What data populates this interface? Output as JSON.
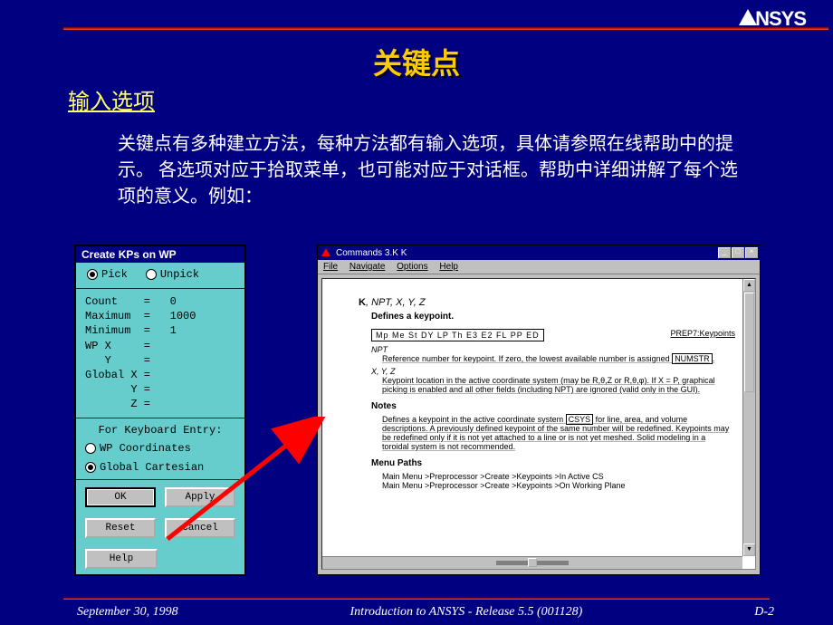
{
  "logo": "NSYS",
  "title": "关键点",
  "subtitle": "输入选项",
  "body": "关键点有多种建立方法，每种方法都有输入选项，具体请参照在线帮助中的提示。 各选项对应于拾取菜单，也可能对应于对话框。帮助中详细讲解了每个选项的意义。例如：",
  "dialog": {
    "title": "Create KPs on WP",
    "pick": "Pick",
    "unpick": "Unpick",
    "kv_lines": "Count    =   0\nMaximum  =   1000\nMinimum  =   1\nWP X     =\n   Y     =\nGlobal X =\n       Y =\n       Z =",
    "entry_label": "For Keyboard Entry:",
    "wp_coords": "WP Coordinates",
    "global_cart": "Global Cartesian",
    "ok": "OK",
    "apply": "Apply",
    "reset": "Reset",
    "cancel": "Cancel",
    "help": "Help"
  },
  "helpwin": {
    "title": "Commands 3.K K",
    "menus": [
      "File",
      "Navigate",
      "Options",
      "Help"
    ],
    "cmd_sig_bold": "K",
    "cmd_sig_rest": ", NPT, X, Y, Z",
    "defines": "Defines a keypoint.",
    "right_link": "PREP7:Keypoints",
    "toolbar": "Mp Me St DY LP Th E3 E2 FL PP ED",
    "arg1_name": "NPT",
    "arg1_text_a": "Reference number for keypoint.  If zero, the lowest available number is assigned",
    "arg1_box": "NUMSTR",
    "arg1_text_b": ".",
    "arg2_name": "X, Y, Z",
    "arg2_text": "Keypoint location in the active coordinate system (may be R,θ,Z or R,θ,φ).  If X = P, graphical picking is enabled and all other fields (including NPT) are ignored (valid only in the GUI).",
    "notes_h": "Notes",
    "notes_text_a": "Defines a keypoint in the active coordinate system ",
    "notes_box": "CSYS",
    "notes_text_b": " for line, area, and volume descriptions.  A previously defined keypoint of the same number will be redefined.  Keypoints may be redefined only if it is not yet attached to a line or is not yet meshed.  Solid modeling in a toroidal system is not recommended.",
    "menupaths_h": "Menu Paths",
    "mp1": "Main Menu >Preprocessor >Create >Keypoints >In Active CS",
    "mp2": "Main Menu >Preprocessor >Create >Keypoints >On Working Plane"
  },
  "footer": {
    "date": "September 30, 1998",
    "center": "Introduction to ANSYS - Release 5.5 (001128)",
    "page": "D-2"
  }
}
